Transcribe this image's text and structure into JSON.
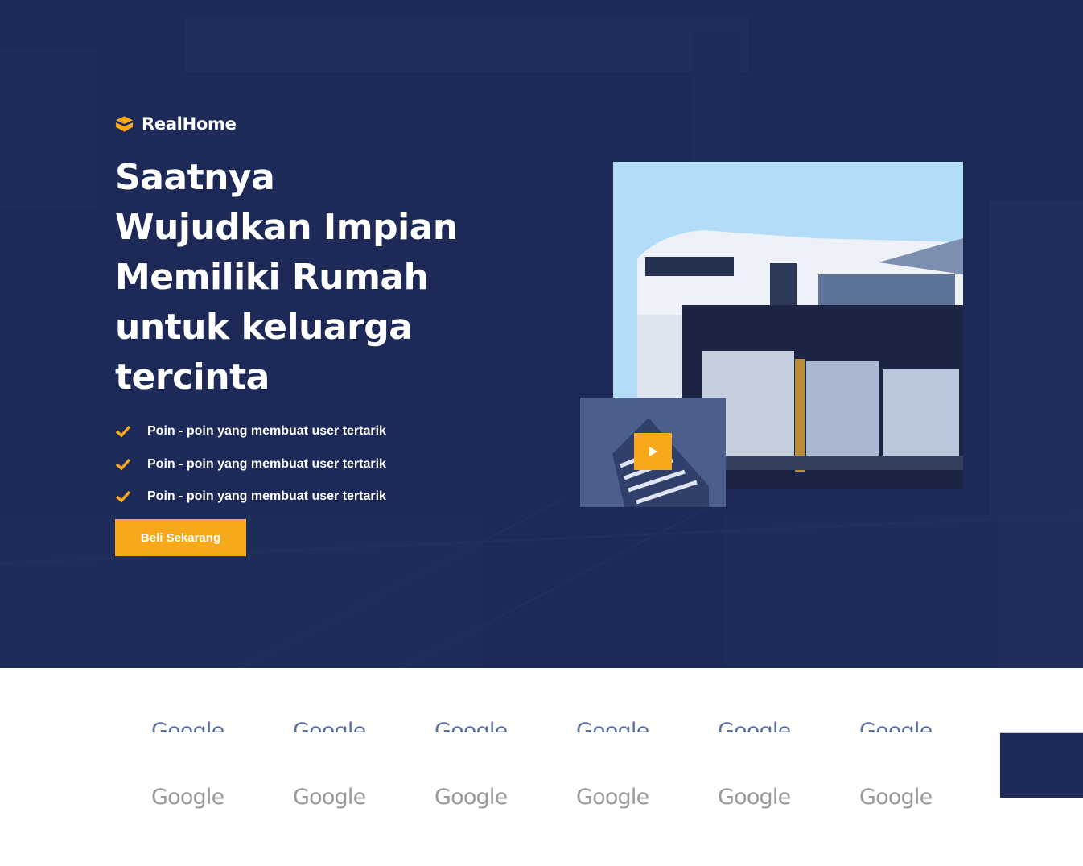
{
  "brand": {
    "name": "RealHome",
    "logo_icon": "stacked-box-logo",
    "accent": "#f7a81b"
  },
  "hero": {
    "background": "#1d2a57",
    "headline_lines": [
      "Saatnya",
      "Wujudkan Impian",
      "Memiliki Rumah",
      "untuk keluarga",
      "tercinta"
    ],
    "points": [
      "Poin - poin yang membuat user tertarik",
      "Poin - poin yang membuat user tertarik",
      "Poin - poin yang membuat user tertarik"
    ],
    "point_icon": "check-icon",
    "cta_label": "Beli Sekarang",
    "media": {
      "main_image": "modern-house-photo",
      "video_thumb": "tower-building-photo",
      "play_icon": "play-icon"
    }
  },
  "logos": {
    "top_row": [
      "Google",
      "Google",
      "Google",
      "Google",
      "Google",
      "Google"
    ],
    "bottom_row": [
      "Google",
      "Google",
      "Google",
      "Google",
      "Google",
      "Google"
    ]
  }
}
